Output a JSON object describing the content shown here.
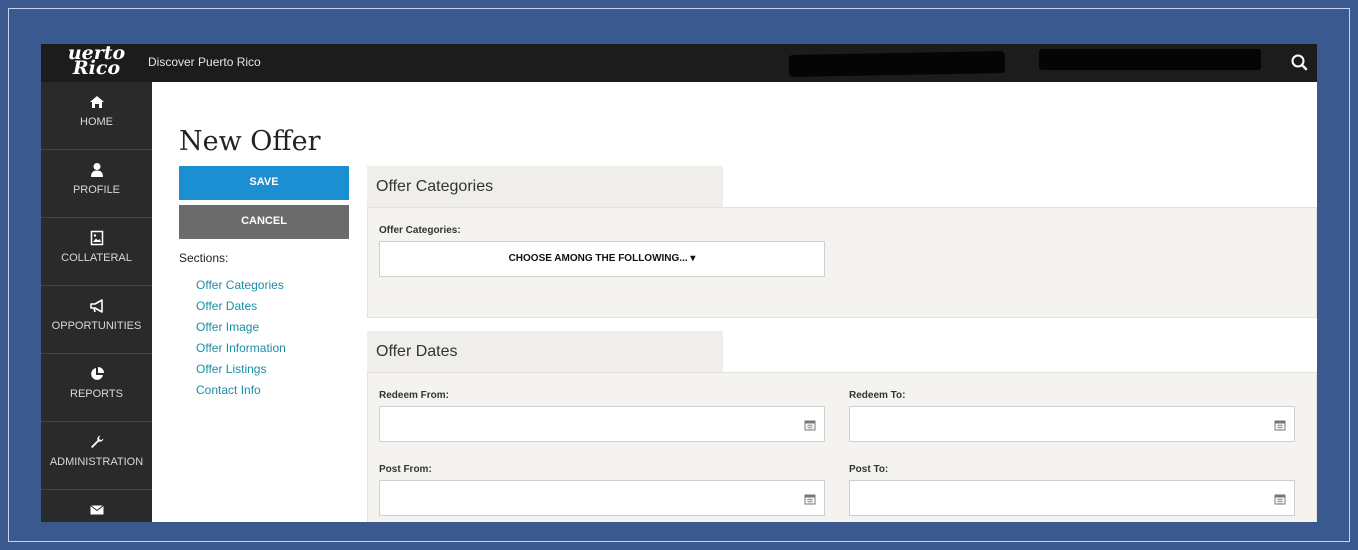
{
  "header": {
    "logo_line1": "uerto",
    "logo_line2": "Rico",
    "site_name": "Discover Puerto Rico",
    "search_icon": "search-icon"
  },
  "sidebar": {
    "items": [
      {
        "label": "HOME",
        "icon": "home-icon"
      },
      {
        "label": "PROFILE",
        "icon": "user-icon"
      },
      {
        "label": "COLLATERAL",
        "icon": "image-file-icon"
      },
      {
        "label": "OPPORTUNITIES",
        "icon": "megaphone-icon"
      },
      {
        "label": "REPORTS",
        "icon": "pie-chart-icon"
      },
      {
        "label": "ADMINISTRATION",
        "icon": "wrench-icon"
      },
      {
        "label": "",
        "icon": "envelope-icon"
      }
    ]
  },
  "page": {
    "title": "New Offer",
    "save_label": "SAVE",
    "cancel_label": "CANCEL",
    "sections_title": "Sections:",
    "sections": [
      "Offer Categories",
      "Offer Dates",
      "Offer Image",
      "Offer Information",
      "Offer Listings",
      "Contact Info"
    ]
  },
  "offer_categories": {
    "tab_title": "Offer Categories",
    "field_label": "Offer Categories:",
    "dropdown_value": "CHOOSE AMONG THE FOLLOWING... ▾"
  },
  "offer_dates": {
    "tab_title": "Offer Dates",
    "redeem_from_label": "Redeem From:",
    "redeem_to_label": "Redeem To:",
    "post_from_label": "Post From:",
    "post_to_label": "Post To:"
  },
  "colors": {
    "frame": "#3a5a8f",
    "topbar": "#1c1c1c",
    "sidebar": "#2a2a2a",
    "save": "#1b8fd2",
    "cancel": "#6b6b6b",
    "link": "#1a8fa6",
    "panel": "#f4f3ef"
  }
}
